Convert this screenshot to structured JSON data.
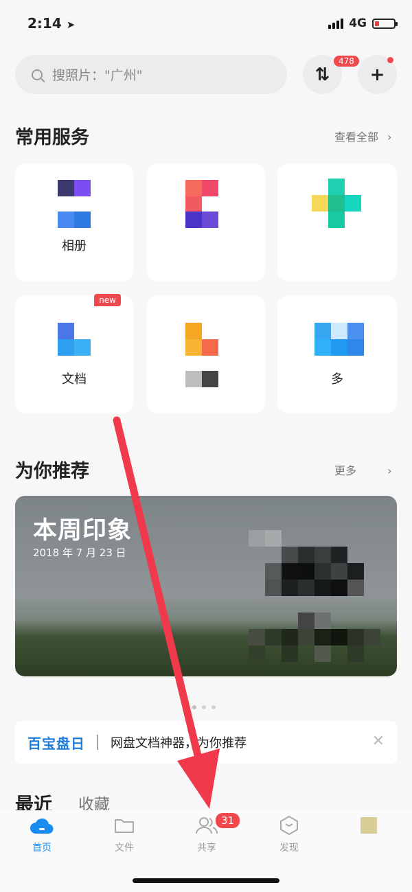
{
  "status": {
    "time": "2:14",
    "network": "4G"
  },
  "search": {
    "placeholder": "搜照片：\"广州\""
  },
  "transfer": {
    "badge": "478"
  },
  "services": {
    "title": "常用服务",
    "view_all": "查看全部",
    "items": [
      {
        "label": "相册"
      },
      {
        "label": ""
      },
      {
        "label": ""
      },
      {
        "label": "文档",
        "badge": "new"
      },
      {
        "label": ""
      },
      {
        "label": "多"
      }
    ]
  },
  "recommend": {
    "title": "为你推荐",
    "more": "更多",
    "banner_title": "本周印象",
    "banner_date": "2018 年 7 月 23 日"
  },
  "ad": {
    "logo": "百宝盘日",
    "text": "网盘文档神器，为你推荐"
  },
  "tabs": {
    "recent": "最近",
    "favorites": "收藏"
  },
  "nav": {
    "items": [
      {
        "label": "首页"
      },
      {
        "label": "文件"
      },
      {
        "label": "共享",
        "badge": "31"
      },
      {
        "label": "发现"
      }
    ]
  },
  "colors": {
    "accent": "#1a8cf0",
    "badge": "#f0494d",
    "arrow": "#f03a4b"
  }
}
